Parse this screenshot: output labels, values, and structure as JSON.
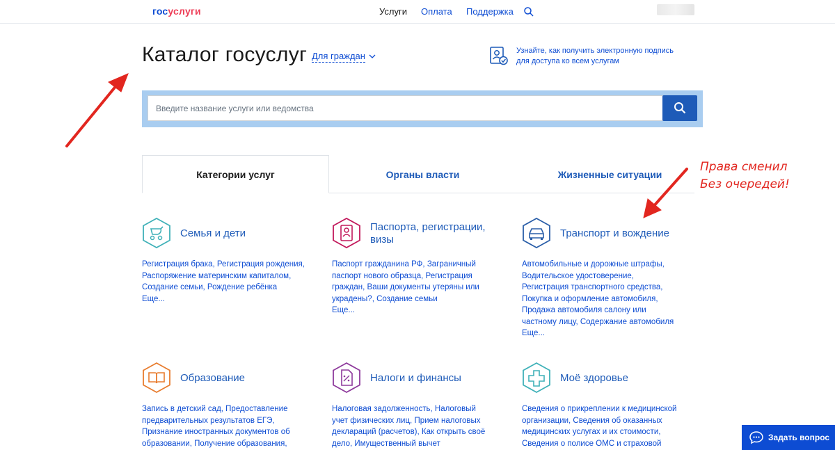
{
  "header": {
    "logo_part1": "гос",
    "logo_part2": "услуги",
    "nav": [
      "Услуги",
      "Оплата",
      "Поддержка"
    ]
  },
  "catalog": {
    "title": "Каталог госуслуг",
    "audience": "Для граждан",
    "signature_text": "Узнайте, как получить электронную подпись для доступа ко всем услугам"
  },
  "search": {
    "placeholder": "Введите название услуги или ведомства"
  },
  "tabs": [
    "Категории услуг",
    "Органы власти",
    "Жизненные ситуации"
  ],
  "annotation": {
    "line1": "Права сменил",
    "line2": "Без очередей!",
    "color": "#e2261f"
  },
  "categories": [
    {
      "title": "Семья и дети",
      "desc": "Регистрация брака, Регистрация рождения, Распоряжение материнским капиталом, Создание семьи, Рождение ребёнка",
      "more": "Еще...",
      "icon": "stroller-icon",
      "color": "#3fb1b8"
    },
    {
      "title": "Паспорта, регистрации, визы",
      "desc": "Паспорт гражданина РФ, Заграничный паспорт нового образца, Регистрация граждан, Ваши документы утеряны или украдены?, Создание семьи",
      "more": "Еще...",
      "icon": "passport-icon",
      "color": "#c2185b"
    },
    {
      "title": "Транспорт и вождение",
      "desc": "Автомобильные и дорожные штрафы, Водительское удостоверение, Регистрация транспортного средства, Покупка и оформление автомобиля, Продажа автомобиля салону или частному лицу, Содержание автомобиля",
      "more": "Еще...",
      "icon": "car-icon",
      "color": "#2a5ea8"
    },
    {
      "title": "Образование",
      "desc": "Запись в детский сад, Предоставление предварительных результатов ЕГЭ, Признание иностранных документов об образовании, Получение образования,",
      "more": "",
      "icon": "book-icon",
      "color": "#e87c2e"
    },
    {
      "title": "Налоги и финансы",
      "desc": "Налоговая задолженность, Налоговый учет физических лиц, Прием налоговых деклараций (расчетов), Как открыть своё дело, Имущественный вычет",
      "more": "",
      "icon": "tax-document-icon",
      "color": "#8e3a9c"
    },
    {
      "title": "Моё здоровье",
      "desc": "Сведения о прикреплении к медицинской организации, Сведения об оказанных медицинских услугах и их стоимости, Сведения о полисе ОМС и страховой",
      "more": "",
      "icon": "medical-cross-icon",
      "color": "#3fb1b8"
    }
  ],
  "chat": {
    "label": "Задать вопрос"
  }
}
